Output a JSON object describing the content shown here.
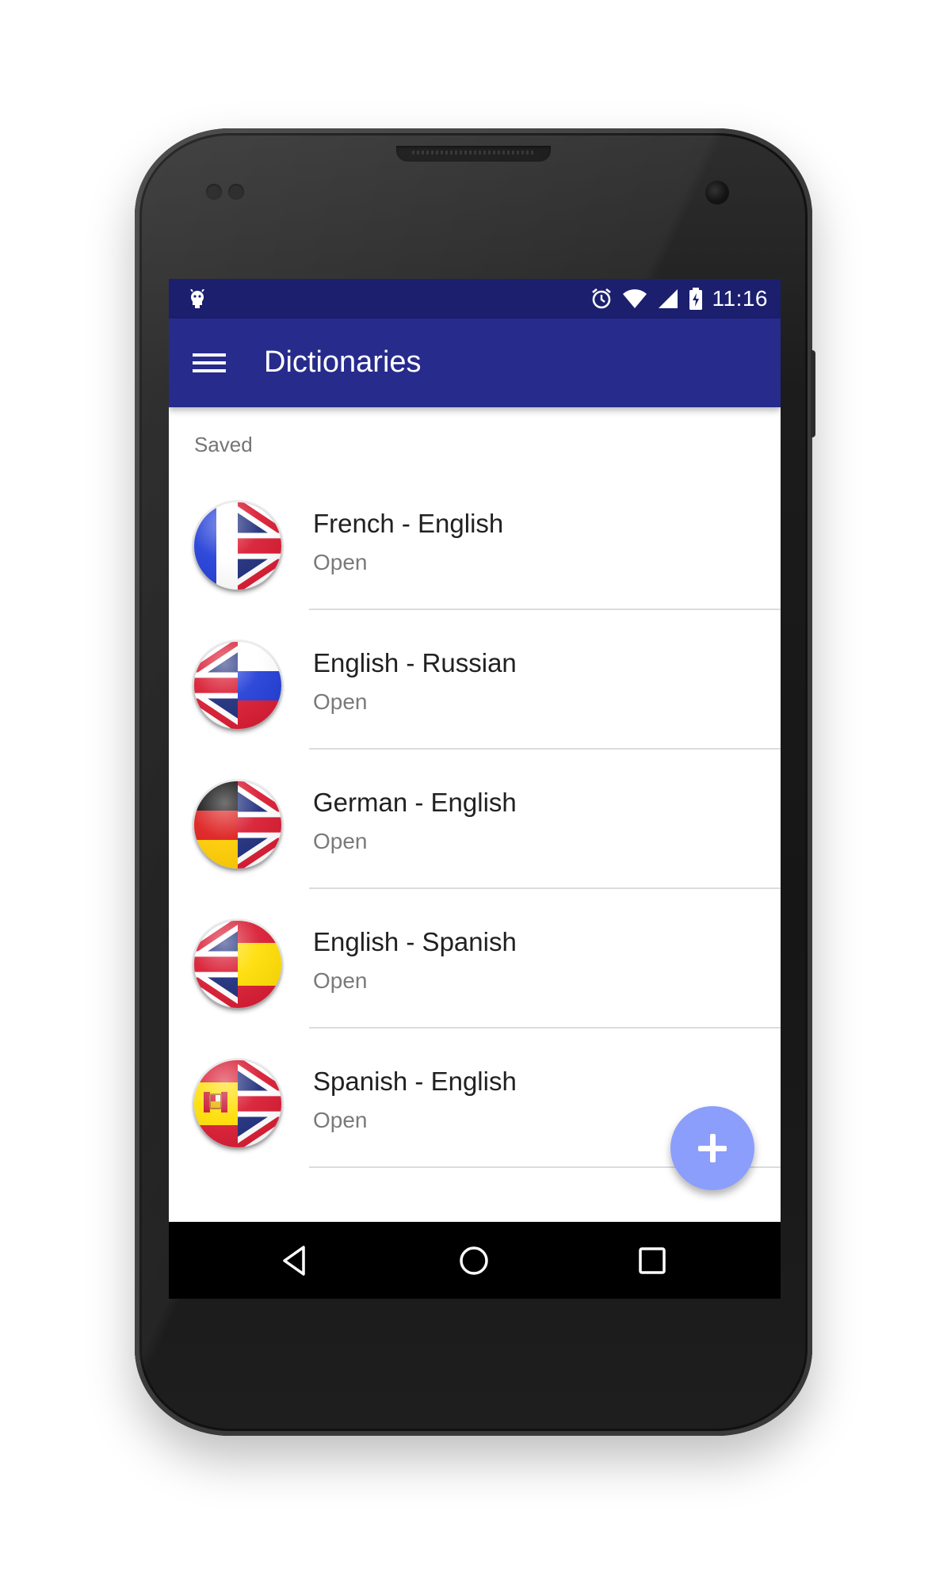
{
  "status_bar": {
    "time": "11:16",
    "icons": [
      "android-debug-icon",
      "alarm-icon",
      "wifi-icon",
      "signal-icon",
      "battery-charging-icon"
    ]
  },
  "toolbar": {
    "title": "Dictionaries",
    "menu_icon": "hamburger-menu-icon"
  },
  "section": {
    "header": "Saved"
  },
  "dictionaries": [
    {
      "title": "French - English",
      "subtitle": "Open",
      "flags": [
        "france",
        "united-kingdom"
      ]
    },
    {
      "title": "English - Russian",
      "subtitle": "Open",
      "flags": [
        "united-kingdom",
        "russia"
      ]
    },
    {
      "title": "German - English",
      "subtitle": "Open",
      "flags": [
        "germany",
        "united-kingdom"
      ]
    },
    {
      "title": "English - Spanish",
      "subtitle": "Open",
      "flags": [
        "united-kingdom",
        "spain"
      ]
    },
    {
      "title": "Spanish - English",
      "subtitle": "Open",
      "flags": [
        "spain",
        "united-kingdom"
      ]
    }
  ],
  "fab": {
    "icon": "plus-icon",
    "color": "#8c9efb"
  },
  "nav_bar": {
    "icons": [
      "back-icon",
      "home-icon",
      "recents-icon"
    ]
  },
  "colors": {
    "status_bar": "#1b1f6e",
    "toolbar": "#272b8c",
    "primary_text": "#212121",
    "secondary_text": "#7a7a7a"
  }
}
